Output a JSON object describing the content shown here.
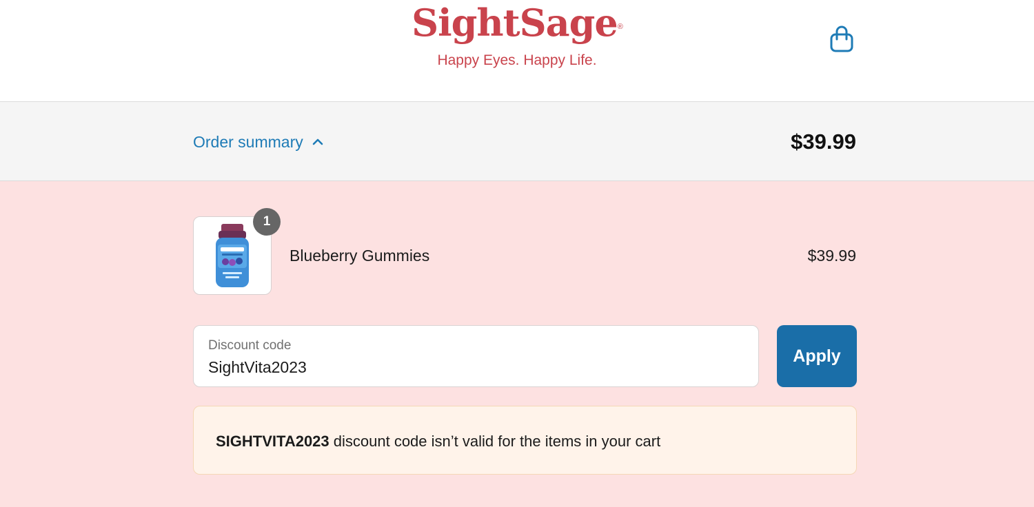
{
  "header": {
    "logo_title": "SightSage",
    "logo_registered": "®",
    "logo_tagline": "Happy Eyes. Happy Life.",
    "cart_icon": "shopping-bag-icon"
  },
  "summary": {
    "toggle_label": "Order summary",
    "toggle_icon": "chevron-up-icon",
    "total": "$39.99"
  },
  "cart": {
    "items": [
      {
        "name": "Blueberry Gummies",
        "price": "$39.99",
        "quantity": "1",
        "image_icon": "gummies-bottle-icon"
      }
    ]
  },
  "discount": {
    "label": "Discount code",
    "value": "SightVita2023",
    "apply_label": "Apply"
  },
  "notice": {
    "code": "SIGHTVITA2023",
    "message": " discount code isn’t valid for the items in your cart"
  },
  "colors": {
    "brand": "#c9434c",
    "link": "#1e7bb6",
    "button": "#1a6ea8",
    "page_background": "#fde1e1",
    "notice_background": "#fff3ea"
  }
}
